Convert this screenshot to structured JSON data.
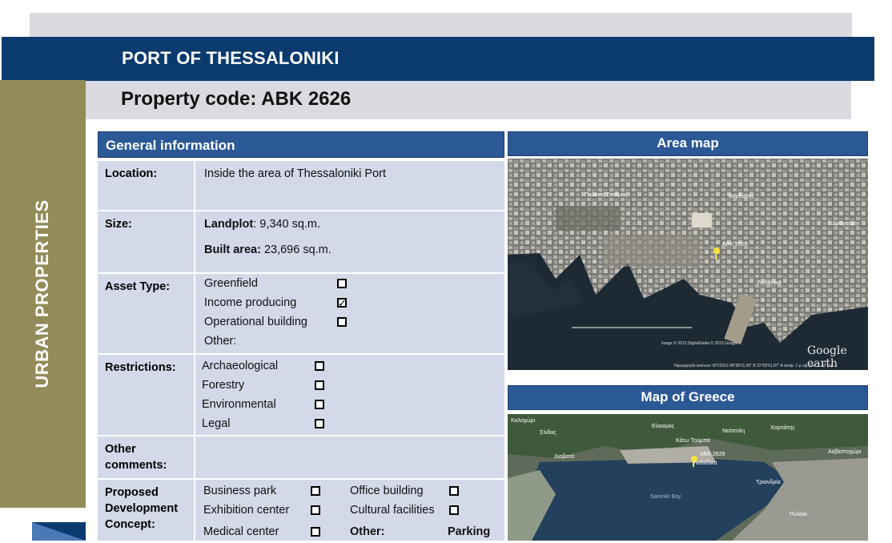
{
  "header": {
    "title": "PORT OF THESSALONIKI",
    "property_code": "Property code: ABK 2626",
    "side_label": "URBAN PROPERTIES"
  },
  "general_info": {
    "heading": "General information",
    "location": {
      "label": "Location:",
      "value": "Inside the area of  Thessaloniki Port"
    },
    "size": {
      "label": "Size:",
      "landplot_label": "Landplot",
      "landplot_value": ": 9,340 sq.m.",
      "built_label": "Built area:",
      "built_value": " 23,696 sq.m."
    },
    "asset_type": {
      "label": "Asset Type:",
      "options": [
        {
          "text": "Greenfield",
          "checked": false
        },
        {
          "text": "Income producing",
          "checked": true
        },
        {
          "text": "Operational building",
          "checked": false
        }
      ],
      "other": "Other:"
    },
    "restrictions": {
      "label": "Restrictions:",
      "options": [
        {
          "text": "Archaeological",
          "checked": false
        },
        {
          "text": "Forestry",
          "checked": false
        },
        {
          "text": "Environmental",
          "checked": false
        },
        {
          "text": "Legal",
          "checked": false
        }
      ]
    },
    "other_comments": {
      "label_line1": "Other",
      "label_line2": "comments:"
    },
    "development": {
      "label_line1": "Proposed",
      "label_line2": "Development",
      "label_line3": "Concept:",
      "col1": [
        "Business park",
        "Exhibition center",
        "Medical center"
      ],
      "col2": [
        "Office building",
        "Cultural facilities"
      ],
      "other_label": "Other:",
      "other_value": "Parking"
    }
  },
  "area_map": {
    "heading": "Area map",
    "pin_label": "ABK 2626",
    "place_labels": [
      "Παλαιός Σταθμός",
      "Βαρδάρης",
      "Λαδάδικα",
      "Ι. Δραγούμη"
    ],
    "watermark": "Google earth",
    "credits": "Image © 2013 DigitalGlobe  © 2013 Google",
    "status": "Ημερομηνία εικόνων: 8/7/2012   40°38'11.09\" Β   22°55'51.87\" Α  ανύψ.   1 μ   υψ. ματ.   1.43 χλμ"
  },
  "greece_map": {
    "heading": "Map of Greece",
    "pin_label": "ABK 2626",
    "pin_sub": "Λαδάδικα",
    "bay_label": "Saloniki Bay",
    "place_labels": [
      "Καλοχώρι",
      "Εύοσμος",
      "Νεάπολη",
      "Πυλαία",
      "Διαβατά",
      "Σίνδος",
      "Τριανδρία",
      "Κάτω Τούμπα",
      "Χορτιάτης",
      "Ασβεστοχώρι"
    ]
  },
  "colors": {
    "title_bar": "#0b3a6e",
    "gray_bar": "#d9dbe0",
    "side_band": "#938c5a",
    "section_header": "#2b5996",
    "row_bg": "#d3d9e8"
  }
}
